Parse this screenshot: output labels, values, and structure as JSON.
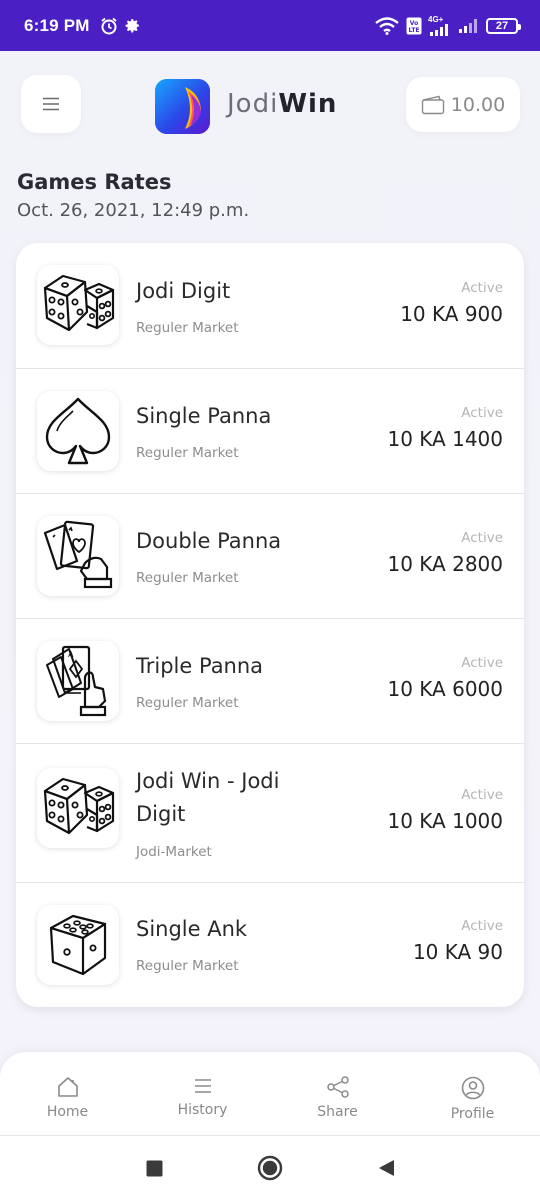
{
  "status_bar": {
    "time": "6:19 PM",
    "network_label": "4G+",
    "battery": "27"
  },
  "header": {
    "brand_part1": "Jodi",
    "brand_part2": "Win",
    "wallet_balance": "10.00"
  },
  "page": {
    "title": "Games Rates",
    "date": "Oct. 26, 2021, 12:49 p.m."
  },
  "games": [
    {
      "name": "Jodi Digit",
      "market": "Reguler Market",
      "status": "Active",
      "rate": "10 KA 900",
      "icon": "dice-pair-icon"
    },
    {
      "name": "Single Panna",
      "market": "Reguler Market",
      "status": "Active",
      "rate": "10 KA 1400",
      "icon": "spade-icon"
    },
    {
      "name": "Double Panna",
      "market": "Reguler Market",
      "status": "Active",
      "rate": "10 KA 2800",
      "icon": "two-cards-hand-icon"
    },
    {
      "name": "Triple Panna",
      "market": "Reguler Market",
      "status": "Active",
      "rate": "10 KA 6000",
      "icon": "three-cards-hand-icon"
    },
    {
      "name": "Jodi Win - Jodi Digit",
      "market": "Jodi-Market",
      "status": "Active",
      "rate": "10 KA 1000",
      "icon": "dice-pair-icon"
    },
    {
      "name": "Single Ank",
      "market": "Reguler Market",
      "status": "Active",
      "rate": "10 KA 90",
      "icon": "single-die-icon"
    }
  ],
  "bottom_nav": [
    {
      "label": "Home",
      "icon": "home-icon"
    },
    {
      "label": "History",
      "icon": "list-icon"
    },
    {
      "label": "Share",
      "icon": "share-icon"
    },
    {
      "label": "Profile",
      "icon": "profile-icon"
    }
  ],
  "colors": {
    "status_bar": "#4a1fc4",
    "card_bg": "#ffffff",
    "page_bg": "#f2f3f9"
  }
}
